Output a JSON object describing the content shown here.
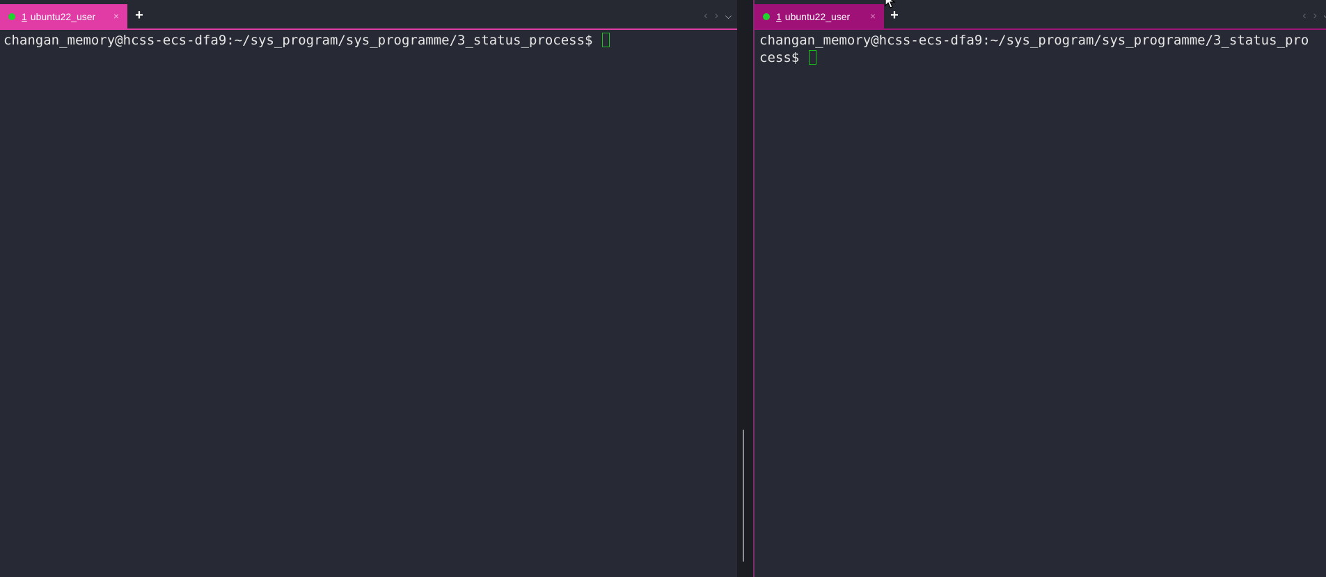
{
  "left_pane": {
    "tab": {
      "index": "1",
      "label": "ubuntu22_user",
      "close": "×"
    },
    "add_tab": "+",
    "nav": {
      "prev": "‹",
      "next": "›",
      "dropdown": "⌵"
    },
    "terminal": {
      "prompt": "changan_memory@hcss-ecs-dfa9:~/sys_program/sys_programme/3_status_process$ "
    }
  },
  "right_pane": {
    "tab": {
      "index": "1",
      "label": "ubuntu22_user",
      "close": "×"
    },
    "add_tab": "+",
    "nav": {
      "prev": "‹",
      "next": "›",
      "dropdown": "⌵"
    },
    "terminal": {
      "prompt": "changan_memory@hcss-ecs-dfa9:~/sys_program/sys_programme/3_status_process$ "
    }
  },
  "colors": {
    "active_tab_left": "#e13ba6",
    "active_tab_right": "#a01177",
    "status_dot": "#1fd32d",
    "cursor": "#19c51b",
    "background": "#272a34"
  }
}
